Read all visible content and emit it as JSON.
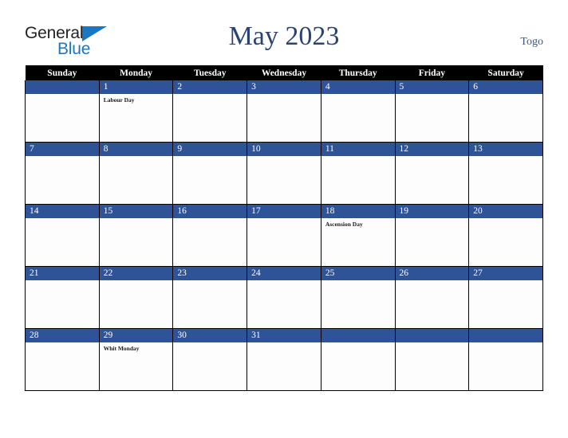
{
  "brand": {
    "line1": "General",
    "line2": "Blue",
    "triangle_icon": "brand-triangle-icon",
    "color_dark": "#231f20",
    "color_blue": "#1b77c0"
  },
  "header": {
    "title": "May 2023",
    "country": "Togo",
    "title_color": "#2b4372"
  },
  "calendar": {
    "month": "May",
    "year": "2023",
    "accent_color": "#2e5396",
    "header_bg": "#000000",
    "weekday_headers": [
      "Sunday",
      "Monday",
      "Tuesday",
      "Wednesday",
      "Thursday",
      "Friday",
      "Saturday"
    ],
    "weeks": [
      [
        {
          "day": "",
          "event": ""
        },
        {
          "day": "1",
          "event": "Labour Day"
        },
        {
          "day": "2",
          "event": ""
        },
        {
          "day": "3",
          "event": ""
        },
        {
          "day": "4",
          "event": ""
        },
        {
          "day": "5",
          "event": ""
        },
        {
          "day": "6",
          "event": ""
        }
      ],
      [
        {
          "day": "7",
          "event": ""
        },
        {
          "day": "8",
          "event": ""
        },
        {
          "day": "9",
          "event": ""
        },
        {
          "day": "10",
          "event": ""
        },
        {
          "day": "11",
          "event": ""
        },
        {
          "day": "12",
          "event": ""
        },
        {
          "day": "13",
          "event": ""
        }
      ],
      [
        {
          "day": "14",
          "event": ""
        },
        {
          "day": "15",
          "event": ""
        },
        {
          "day": "16",
          "event": ""
        },
        {
          "day": "17",
          "event": ""
        },
        {
          "day": "18",
          "event": "Ascension Day"
        },
        {
          "day": "19",
          "event": ""
        },
        {
          "day": "20",
          "event": ""
        }
      ],
      [
        {
          "day": "21",
          "event": ""
        },
        {
          "day": "22",
          "event": ""
        },
        {
          "day": "23",
          "event": ""
        },
        {
          "day": "24",
          "event": ""
        },
        {
          "day": "25",
          "event": ""
        },
        {
          "day": "26",
          "event": ""
        },
        {
          "day": "27",
          "event": ""
        }
      ],
      [
        {
          "day": "28",
          "event": ""
        },
        {
          "day": "29",
          "event": "Whit Monday"
        },
        {
          "day": "30",
          "event": ""
        },
        {
          "day": "31",
          "event": ""
        },
        {
          "day": "",
          "event": ""
        },
        {
          "day": "",
          "event": ""
        },
        {
          "day": "",
          "event": ""
        }
      ]
    ]
  }
}
